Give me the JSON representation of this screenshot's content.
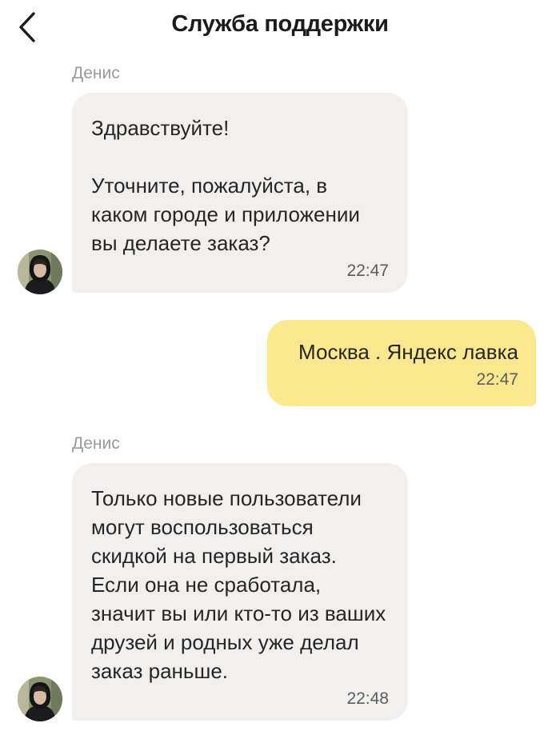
{
  "header": {
    "title": "Служба поддержки",
    "back_icon": "chevron-left-icon"
  },
  "messages": [
    {
      "direction": "incoming",
      "sender": "Денис",
      "text": "Здравствуйте!\n\nУточните, пожалуйста, в каком городе и приложении вы делаете заказ?",
      "time": "22:47"
    },
    {
      "direction": "outgoing",
      "text": "Москва . Яндекс лавка",
      "time": "22:47"
    },
    {
      "direction": "incoming",
      "sender": "Денис",
      "text": "Только новые пользователи могут воспользоваться скидкой на первый заказ. Если она не сработала, значит вы или кто-то из ваших друзей и родных уже делал заказ раньше.",
      "time": "22:48"
    }
  ],
  "colors": {
    "incoming_bubble": "#f1f0ef",
    "outgoing_bubble": "#fbe88f",
    "sender_name": "#9a9a9a"
  }
}
